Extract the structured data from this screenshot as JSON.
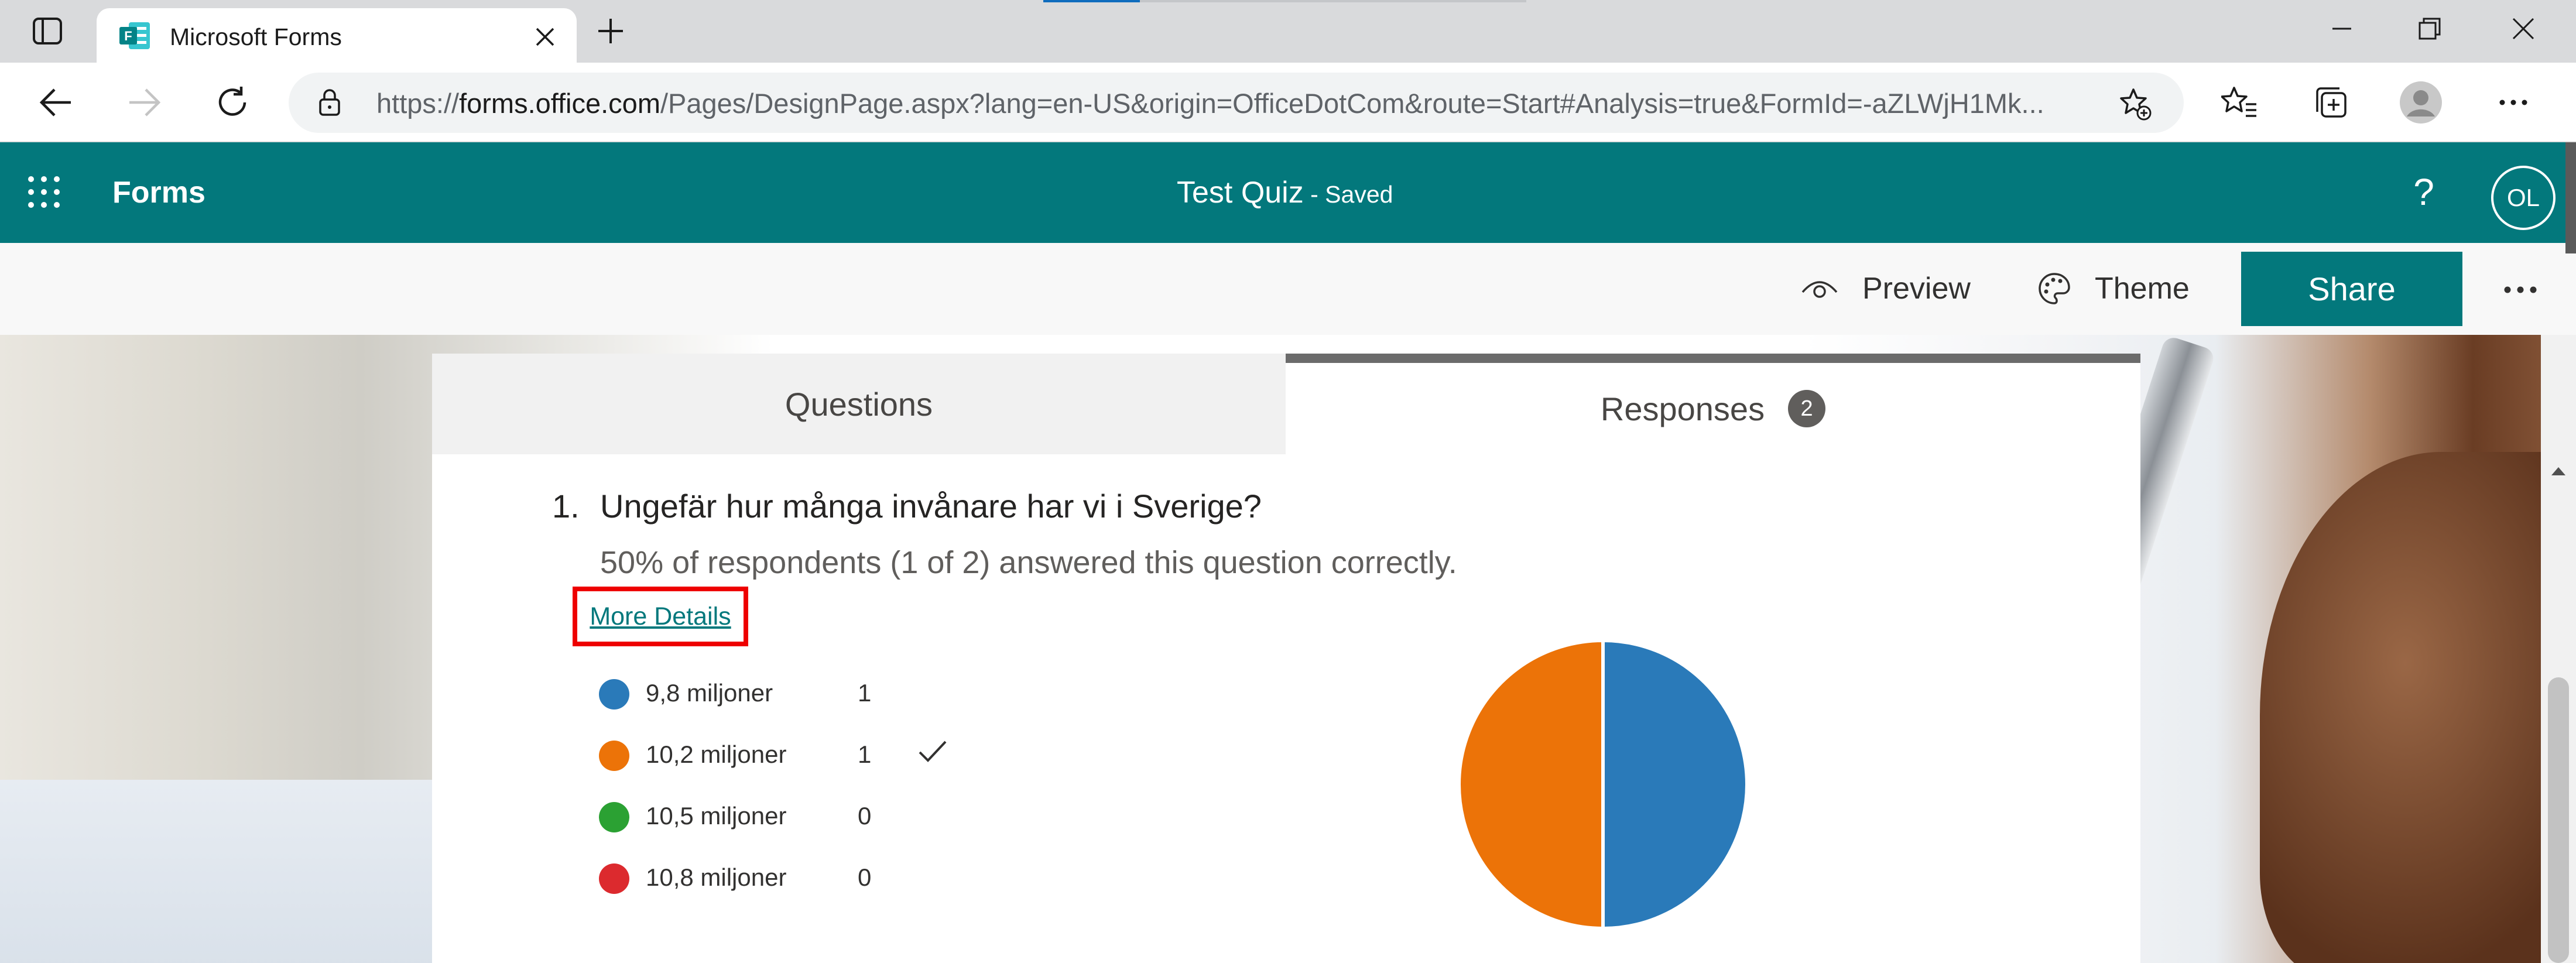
{
  "browser": {
    "tab_title": "Microsoft Forms",
    "url_prefix": "https://",
    "url_host": "forms.office.com",
    "url_rest": "/Pages/DesignPage.aspx?lang=en-US&origin=OfficeDotCom&route=Start#Analysis=true&FormId=-aZLWjH1Mk..."
  },
  "app": {
    "name": "Forms",
    "doc_title": "Test Quiz",
    "doc_status": " - Saved",
    "help_label": "?",
    "avatar_initials": "OL"
  },
  "commandbar": {
    "preview_label": "Preview",
    "theme_label": "Theme",
    "share_label": "Share"
  },
  "tabs": {
    "questions_label": "Questions",
    "responses_label": "Responses",
    "responses_count": "2"
  },
  "question": {
    "number": "1.",
    "title": "Ungefär hur många invånare har vi i Sverige?",
    "summary": "50% of respondents (1 of 2) answered this question correctly.",
    "more_details_label": "More Details",
    "options": [
      {
        "label": "9,8 miljoner",
        "count": "1",
        "color": "#2a7ab9",
        "correct": false
      },
      {
        "label": "10,2 miljoner",
        "count": "1",
        "color": "#ec7308",
        "correct": true
      },
      {
        "label": "10,5 miljoner",
        "count": "0",
        "color": "#2ba133",
        "correct": false
      },
      {
        "label": "10,8 miljoner",
        "count": "0",
        "color": "#dc2a2e",
        "correct": false
      }
    ]
  },
  "chart_data": {
    "type": "pie",
    "categories": [
      "9,8 miljoner",
      "10,2 miljoner",
      "10,5 miljoner",
      "10,8 miljoner"
    ],
    "values": [
      1,
      1,
      0,
      0
    ],
    "colors": [
      "#2a7ab9",
      "#ec7308",
      "#2ba133",
      "#dc2a2e"
    ]
  },
  "theme": {
    "accent": "#03787c",
    "highlight_box": "#ee0000"
  }
}
